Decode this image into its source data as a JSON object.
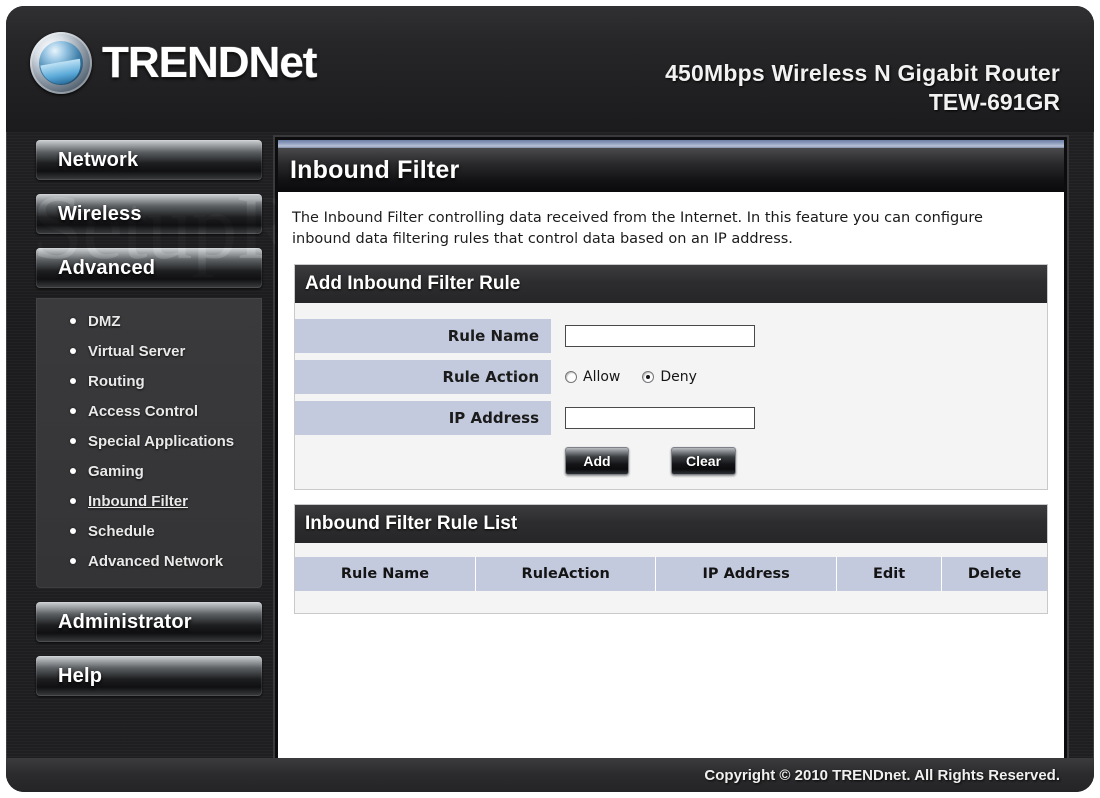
{
  "header": {
    "brand_upper": "TRENDN",
    "brand_lower": "et",
    "brand_full": "TRENDnet",
    "product_name": "450Mbps Wireless N Gigabit Router",
    "model": "TEW-691GR"
  },
  "watermark": {
    "text": "SetupRouter.com"
  },
  "sidebar": {
    "sections": [
      {
        "label": "Network"
      },
      {
        "label": "Wireless"
      },
      {
        "label": "Advanced"
      }
    ],
    "submenu": [
      {
        "label": "DMZ",
        "active": false
      },
      {
        "label": "Virtual Server",
        "active": false
      },
      {
        "label": "Routing",
        "active": false
      },
      {
        "label": "Access Control",
        "active": false
      },
      {
        "label": "Special Applications",
        "active": false
      },
      {
        "label": "Gaming",
        "active": false
      },
      {
        "label": "Inbound Filter",
        "active": true
      },
      {
        "label": "Schedule",
        "active": false
      },
      {
        "label": "Advanced Network",
        "active": false
      }
    ],
    "bottom_sections": [
      {
        "label": "Administrator"
      },
      {
        "label": "Help"
      }
    ]
  },
  "main": {
    "page_title": "Inbound Filter",
    "intro": "The Inbound Filter controlling data received from the Internet. In this feature you can configure inbound data filtering rules that control data based on an IP address.",
    "add_rule": {
      "title": "Add Inbound Filter Rule",
      "fields": {
        "rule_name_label": "Rule Name",
        "rule_name_value": "",
        "rule_name_placeholder": "",
        "rule_action_label": "Rule Action",
        "rule_action_options": [
          {
            "label": "Allow",
            "selected": false
          },
          {
            "label": "Deny",
            "selected": true
          }
        ],
        "ip_address_label": "IP Address",
        "ip_address_value": "",
        "ip_address_placeholder": ""
      },
      "buttons": {
        "add": "Add",
        "clear": "Clear"
      }
    },
    "rule_list": {
      "title": "Inbound Filter Rule List",
      "columns": [
        "Rule Name",
        "RuleAction",
        "IP Address",
        "Edit",
        "Delete"
      ],
      "rows": []
    }
  },
  "footer": {
    "copyright": "Copyright © 2010 TRENDnet. All Rights Reserved."
  },
  "colors": {
    "label_blue": "#c4cade",
    "panel_bg": "#f4f4f4",
    "frame_dark": "#1d1d1f",
    "accent_top": "#8e9dbd"
  }
}
